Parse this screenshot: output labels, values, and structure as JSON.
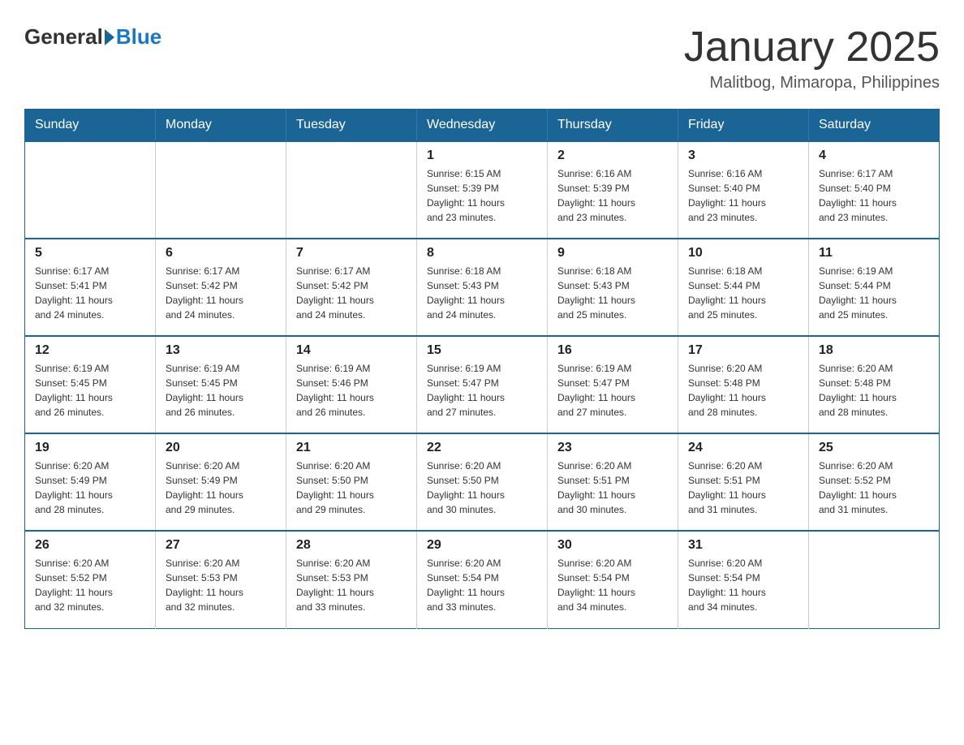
{
  "logo": {
    "general": "General",
    "blue": "Blue"
  },
  "title": "January 2025",
  "location": "Malitbog, Mimaropa, Philippines",
  "days_of_week": [
    "Sunday",
    "Monday",
    "Tuesday",
    "Wednesday",
    "Thursday",
    "Friday",
    "Saturday"
  ],
  "weeks": [
    [
      {
        "day": "",
        "info": ""
      },
      {
        "day": "",
        "info": ""
      },
      {
        "day": "",
        "info": ""
      },
      {
        "day": "1",
        "info": "Sunrise: 6:15 AM\nSunset: 5:39 PM\nDaylight: 11 hours\nand 23 minutes."
      },
      {
        "day": "2",
        "info": "Sunrise: 6:16 AM\nSunset: 5:39 PM\nDaylight: 11 hours\nand 23 minutes."
      },
      {
        "day": "3",
        "info": "Sunrise: 6:16 AM\nSunset: 5:40 PM\nDaylight: 11 hours\nand 23 minutes."
      },
      {
        "day": "4",
        "info": "Sunrise: 6:17 AM\nSunset: 5:40 PM\nDaylight: 11 hours\nand 23 minutes."
      }
    ],
    [
      {
        "day": "5",
        "info": "Sunrise: 6:17 AM\nSunset: 5:41 PM\nDaylight: 11 hours\nand 24 minutes."
      },
      {
        "day": "6",
        "info": "Sunrise: 6:17 AM\nSunset: 5:42 PM\nDaylight: 11 hours\nand 24 minutes."
      },
      {
        "day": "7",
        "info": "Sunrise: 6:17 AM\nSunset: 5:42 PM\nDaylight: 11 hours\nand 24 minutes."
      },
      {
        "day": "8",
        "info": "Sunrise: 6:18 AM\nSunset: 5:43 PM\nDaylight: 11 hours\nand 24 minutes."
      },
      {
        "day": "9",
        "info": "Sunrise: 6:18 AM\nSunset: 5:43 PM\nDaylight: 11 hours\nand 25 minutes."
      },
      {
        "day": "10",
        "info": "Sunrise: 6:18 AM\nSunset: 5:44 PM\nDaylight: 11 hours\nand 25 minutes."
      },
      {
        "day": "11",
        "info": "Sunrise: 6:19 AM\nSunset: 5:44 PM\nDaylight: 11 hours\nand 25 minutes."
      }
    ],
    [
      {
        "day": "12",
        "info": "Sunrise: 6:19 AM\nSunset: 5:45 PM\nDaylight: 11 hours\nand 26 minutes."
      },
      {
        "day": "13",
        "info": "Sunrise: 6:19 AM\nSunset: 5:45 PM\nDaylight: 11 hours\nand 26 minutes."
      },
      {
        "day": "14",
        "info": "Sunrise: 6:19 AM\nSunset: 5:46 PM\nDaylight: 11 hours\nand 26 minutes."
      },
      {
        "day": "15",
        "info": "Sunrise: 6:19 AM\nSunset: 5:47 PM\nDaylight: 11 hours\nand 27 minutes."
      },
      {
        "day": "16",
        "info": "Sunrise: 6:19 AM\nSunset: 5:47 PM\nDaylight: 11 hours\nand 27 minutes."
      },
      {
        "day": "17",
        "info": "Sunrise: 6:20 AM\nSunset: 5:48 PM\nDaylight: 11 hours\nand 28 minutes."
      },
      {
        "day": "18",
        "info": "Sunrise: 6:20 AM\nSunset: 5:48 PM\nDaylight: 11 hours\nand 28 minutes."
      }
    ],
    [
      {
        "day": "19",
        "info": "Sunrise: 6:20 AM\nSunset: 5:49 PM\nDaylight: 11 hours\nand 28 minutes."
      },
      {
        "day": "20",
        "info": "Sunrise: 6:20 AM\nSunset: 5:49 PM\nDaylight: 11 hours\nand 29 minutes."
      },
      {
        "day": "21",
        "info": "Sunrise: 6:20 AM\nSunset: 5:50 PM\nDaylight: 11 hours\nand 29 minutes."
      },
      {
        "day": "22",
        "info": "Sunrise: 6:20 AM\nSunset: 5:50 PM\nDaylight: 11 hours\nand 30 minutes."
      },
      {
        "day": "23",
        "info": "Sunrise: 6:20 AM\nSunset: 5:51 PM\nDaylight: 11 hours\nand 30 minutes."
      },
      {
        "day": "24",
        "info": "Sunrise: 6:20 AM\nSunset: 5:51 PM\nDaylight: 11 hours\nand 31 minutes."
      },
      {
        "day": "25",
        "info": "Sunrise: 6:20 AM\nSunset: 5:52 PM\nDaylight: 11 hours\nand 31 minutes."
      }
    ],
    [
      {
        "day": "26",
        "info": "Sunrise: 6:20 AM\nSunset: 5:52 PM\nDaylight: 11 hours\nand 32 minutes."
      },
      {
        "day": "27",
        "info": "Sunrise: 6:20 AM\nSunset: 5:53 PM\nDaylight: 11 hours\nand 32 minutes."
      },
      {
        "day": "28",
        "info": "Sunrise: 6:20 AM\nSunset: 5:53 PM\nDaylight: 11 hours\nand 33 minutes."
      },
      {
        "day": "29",
        "info": "Sunrise: 6:20 AM\nSunset: 5:54 PM\nDaylight: 11 hours\nand 33 minutes."
      },
      {
        "day": "30",
        "info": "Sunrise: 6:20 AM\nSunset: 5:54 PM\nDaylight: 11 hours\nand 34 minutes."
      },
      {
        "day": "31",
        "info": "Sunrise: 6:20 AM\nSunset: 5:54 PM\nDaylight: 11 hours\nand 34 minutes."
      },
      {
        "day": "",
        "info": ""
      }
    ]
  ]
}
